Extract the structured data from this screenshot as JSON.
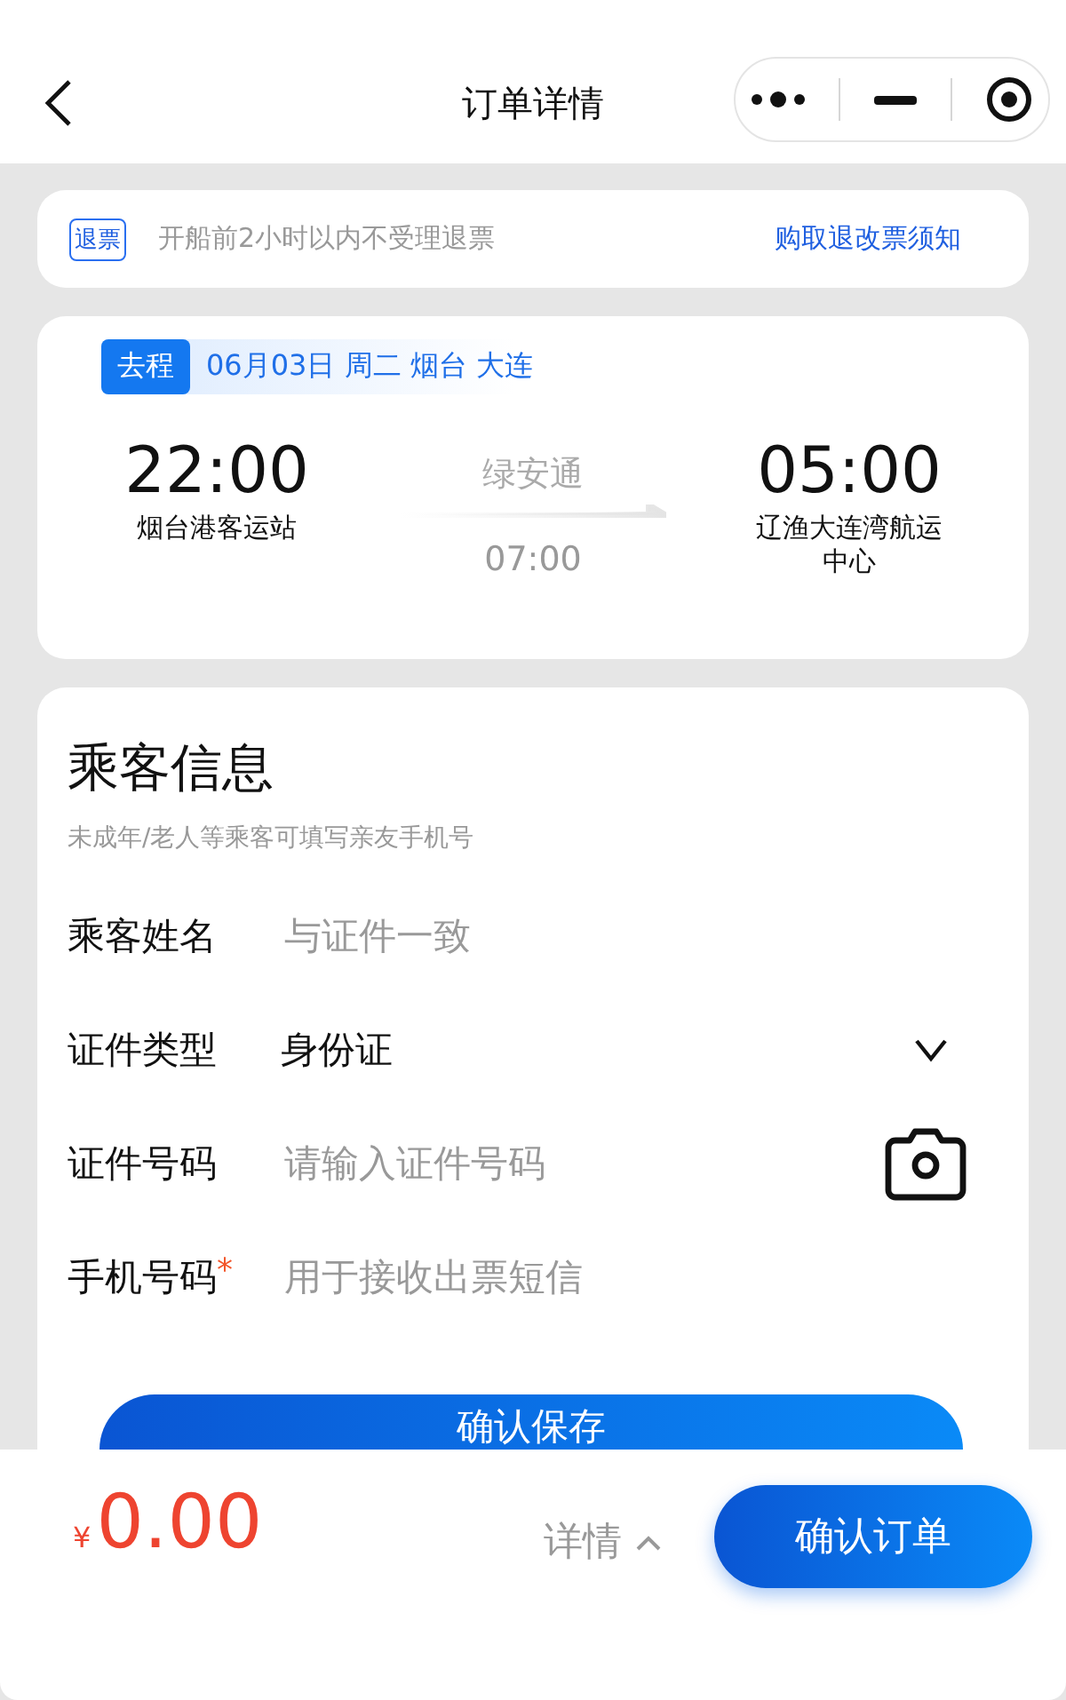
{
  "nav": {
    "title": "订单详情"
  },
  "notice": {
    "tag": "退票",
    "text": "开船前2小时以内不受理退票",
    "link": "购取退改票须知"
  },
  "trip": {
    "direction": "去程",
    "summary": "06月03日 周二 烟台 大连",
    "departure": {
      "time": "22:00",
      "port": "烟台港客运站"
    },
    "vessel": "绿安通",
    "duration": "07:00",
    "arrival": {
      "time": "05:00",
      "port": "辽渔大连湾航运中心"
    }
  },
  "passenger": {
    "title": "乘客信息",
    "hint": "未成年/老人等乘客可填写亲友手机号",
    "fields": [
      {
        "kind": "text",
        "label": "乘客姓名",
        "placeholder": "与证件一致"
      },
      {
        "kind": "select",
        "label": "证件类型",
        "value": "身份证"
      },
      {
        "kind": "scan",
        "label": "证件号码",
        "placeholder": "请输入证件号码"
      },
      {
        "kind": "text",
        "label": "手机号码",
        "required_mark": "*",
        "placeholder": "用于接收出票短信"
      }
    ],
    "save": "确认保存"
  },
  "footer": {
    "currency": "¥",
    "amount": "0.00",
    "details": "详情",
    "confirm": "确认订单"
  }
}
